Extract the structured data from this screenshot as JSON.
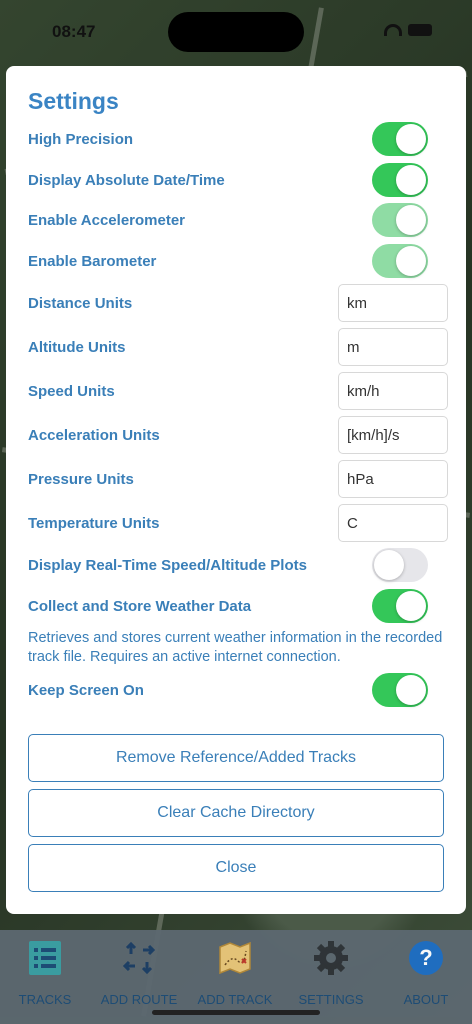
{
  "status_bar": {
    "time": "08:47"
  },
  "settings": {
    "title": "Settings",
    "toggles": [
      {
        "label": "High Precision",
        "state": "on"
      },
      {
        "label": "Display Absolute Date/Time",
        "state": "on"
      },
      {
        "label": "Enable Accelerometer",
        "state": "on-disabled"
      },
      {
        "label": "Enable Barometer",
        "state": "on-disabled"
      }
    ],
    "units": [
      {
        "label": "Distance Units",
        "value": "km"
      },
      {
        "label": "Altitude Units",
        "value": "m"
      },
      {
        "label": "Speed Units",
        "value": "km/h"
      },
      {
        "label": "Acceleration Units",
        "value": "[km/h]/s"
      },
      {
        "label": "Pressure Units",
        "value": "hPa"
      },
      {
        "label": "Temperature Units",
        "value": "C"
      }
    ],
    "realtime_plots": {
      "label": "Display Real-Time Speed/Altitude Plots",
      "state": "off"
    },
    "weather": {
      "label": "Collect and Store Weather Data",
      "state": "on",
      "note": "Retrieves and stores current weather information in the recorded track file. Requires an active internet connection."
    },
    "keep_screen_on": {
      "label": "Keep Screen On",
      "state": "on"
    },
    "buttons": {
      "remove_tracks": "Remove Reference/Added Tracks",
      "clear_cache": "Clear Cache Directory",
      "close": "Close"
    }
  },
  "tabbar": {
    "tabs": [
      {
        "label": "TRACKS",
        "icon": "list-icon"
      },
      {
        "label": "ADD ROUTE",
        "icon": "arrows-icon"
      },
      {
        "label": "ADD TRACK",
        "icon": "treasure-map-icon"
      },
      {
        "label": "SETTINGS",
        "icon": "gear-icon"
      },
      {
        "label": "ABOUT",
        "icon": "question-icon"
      }
    ]
  },
  "colors": {
    "accent": "#3a7fb8",
    "toggle_on": "#34c759",
    "toggle_on_disabled": "#8fdca4",
    "toggle_off": "#e6e6ea"
  }
}
